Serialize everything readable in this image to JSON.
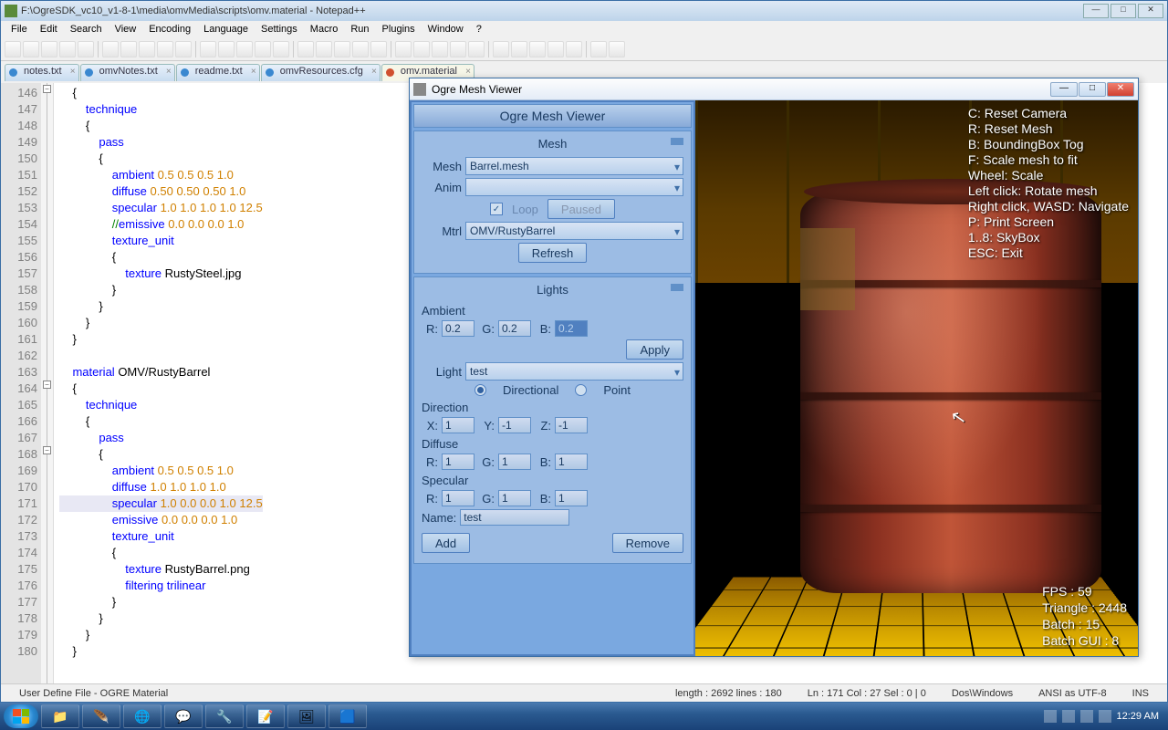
{
  "npp": {
    "title": "F:\\OgreSDK_vc10_v1-8-1\\media\\omvMedia\\scripts\\omv.material - Notepad++",
    "menu": [
      "File",
      "Edit",
      "Search",
      "View",
      "Encoding",
      "Language",
      "Settings",
      "Macro",
      "Run",
      "Plugins",
      "Window",
      "?"
    ],
    "tabs": [
      {
        "label": "notes.txt"
      },
      {
        "label": "omvNotes.txt"
      },
      {
        "label": "readme.txt"
      },
      {
        "label": "omvResources.cfg"
      },
      {
        "label": "omv.material",
        "active": true
      }
    ],
    "lines": {
      "start": 146,
      "end": 180,
      "code": [
        "    {",
        "        technique",
        "        {",
        "            pass",
        "            {",
        "                ambient 0.5 0.5 0.5 1.0",
        "                diffuse 0.50 0.50 0.50 1.0",
        "                specular 1.0 1.0 1.0 1.0 12.5",
        "                //emissive 0.0 0.0 0.0 1.0",
        "                texture_unit",
        "                {",
        "                    texture RustySteel.jpg",
        "                }",
        "            }",
        "        }",
        "    }",
        "",
        "    material OMV/RustyBarrel",
        "    {",
        "        technique",
        "        {",
        "            pass",
        "            {",
        "                ambient 0.5 0.5 0.5 1.0",
        "                diffuse 1.0 1.0 1.0 1.0",
        "                specular 1.0 0.0 0.0 1.0 12.5",
        "                emissive 0.0 0.0 0.0 1.0",
        "                texture_unit",
        "                {",
        "                    texture RustyBarrel.png",
        "                    filtering trilinear",
        "                }",
        "            }",
        "        }",
        "    }"
      ],
      "current_line": 171
    },
    "status": {
      "left": "User Define File - OGRE Material",
      "length": "length : 2692    lines : 180",
      "pos": "Ln : 171    Col : 27    Sel : 0 | 0",
      "eol": "Dos\\Windows",
      "enc": "ANSI as UTF-8",
      "ins": "INS"
    }
  },
  "ogre": {
    "title": "Ogre Mesh Viewer",
    "header": "Ogre Mesh Viewer",
    "mesh": {
      "title": "Mesh",
      "mesh_label": "Mesh",
      "mesh_val": "Barrel.mesh",
      "anim_label": "Anim",
      "anim_val": "",
      "loop": "Loop",
      "paused": "Paused",
      "mtrl_label": "Mtrl",
      "mtrl_val": "OMV/RustyBarrel",
      "refresh": "Refresh"
    },
    "lights": {
      "title": "Lights",
      "ambient": "Ambient",
      "R": "R:",
      "G": "G:",
      "B": "B:",
      "amb_r": "0.2",
      "amb_g": "0.2",
      "amb_b": "0.2",
      "apply": "Apply",
      "light_label": "Light",
      "light_val": "test",
      "directional": "Directional",
      "point": "Point",
      "direction": "Direction",
      "X": "X:",
      "Y": "Y:",
      "Z": "Z:",
      "dx": "1",
      "dy": "-1",
      "dz": "-1",
      "diffuse": "Diffuse",
      "dr": "1",
      "dg": "1",
      "db": "1",
      "specular": "Specular",
      "sr": "1",
      "sg": "1",
      "sb": "1",
      "name_label": "Name:",
      "name_val": "test",
      "add": "Add",
      "remove": "Remove"
    },
    "help": [
      "C: Reset Camera",
      "R: Reset Mesh",
      "B: BoundingBox Tog",
      "F: Scale mesh to fit",
      "Wheel: Scale",
      "Left click: Rotate mesh",
      "Right click, WASD: Navigate",
      "P: Print Screen",
      "1..8: SkyBox",
      "ESC: Exit"
    ],
    "stats": {
      "fps": "FPS : 59",
      "tri": "Triangle : 2448",
      "batch": "Batch : 15",
      "gui": "Batch GUI : 8"
    }
  },
  "taskbar": {
    "time": "12:29 AM"
  }
}
